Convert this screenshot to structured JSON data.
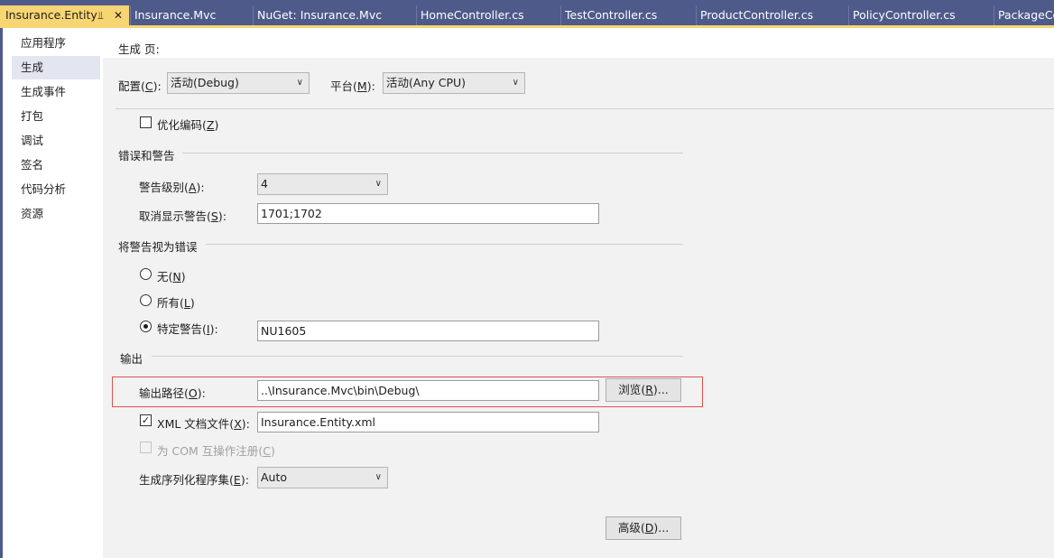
{
  "tabs": [
    {
      "label": "Insurance.Entity",
      "active": true
    },
    {
      "label": "Insurance.Mvc"
    },
    {
      "label": "NuGet: Insurance.Mvc"
    },
    {
      "label": "HomeController.cs"
    },
    {
      "label": "TestController.cs"
    },
    {
      "label": "ProductController.cs"
    },
    {
      "label": "PolicyController.cs"
    },
    {
      "label": "PackageCo"
    }
  ],
  "tab_icons": {
    "pin": "pin-icon",
    "close": "close-icon"
  },
  "nav": {
    "items": [
      "应用程序",
      "生成",
      "生成事件",
      "打包",
      "调试",
      "签名",
      "代码分析",
      "资源"
    ],
    "selected_index": 1
  },
  "page": {
    "title": "生成 页:",
    "config_label": "配置",
    "config_key": "C",
    "config_value": "活动(Debug)",
    "platform_label": "平台",
    "platform_key": "M",
    "platform_value": "活动(Any CPU)",
    "optimize_label": "优化编码",
    "optimize_key": "Z",
    "optimize_checked": false
  },
  "errors": {
    "title": "错误和警告",
    "warning_level_label": "警告级别",
    "warning_level_key": "A",
    "warning_level_value": "4",
    "suppress_label": "取消显示警告",
    "suppress_key": "S",
    "suppress_value": "1701;1702"
  },
  "treat": {
    "title": "将警告视为错误",
    "none_label": "无",
    "none_key": "N",
    "all_label": "所有",
    "all_key": "L",
    "specific_label": "特定警告",
    "specific_key": "I",
    "specific_value": "NU1605",
    "selected": "specific"
  },
  "output": {
    "title": "输出",
    "path_label": "输出路径",
    "path_key": "O",
    "path_value": "..\\Insurance.Mvc\\bin\\Debug\\",
    "browse_label": "浏览",
    "browse_key": "R",
    "xml_label": "XML 文档文件",
    "xml_key": "X",
    "xml_checked": true,
    "xml_value": "Insurance.Entity.xml",
    "com_label": "为 COM 互操作注册",
    "com_key": "C",
    "com_checked": false,
    "serialization_label": "生成序列化程序集",
    "serialization_key": "E",
    "serialization_value": "Auto",
    "advanced_label": "高级",
    "advanced_key": "D"
  },
  "colors": {
    "tab_strip": "#4d5a8a",
    "active_tab": "#f7d572",
    "highlight": "#e05050"
  }
}
